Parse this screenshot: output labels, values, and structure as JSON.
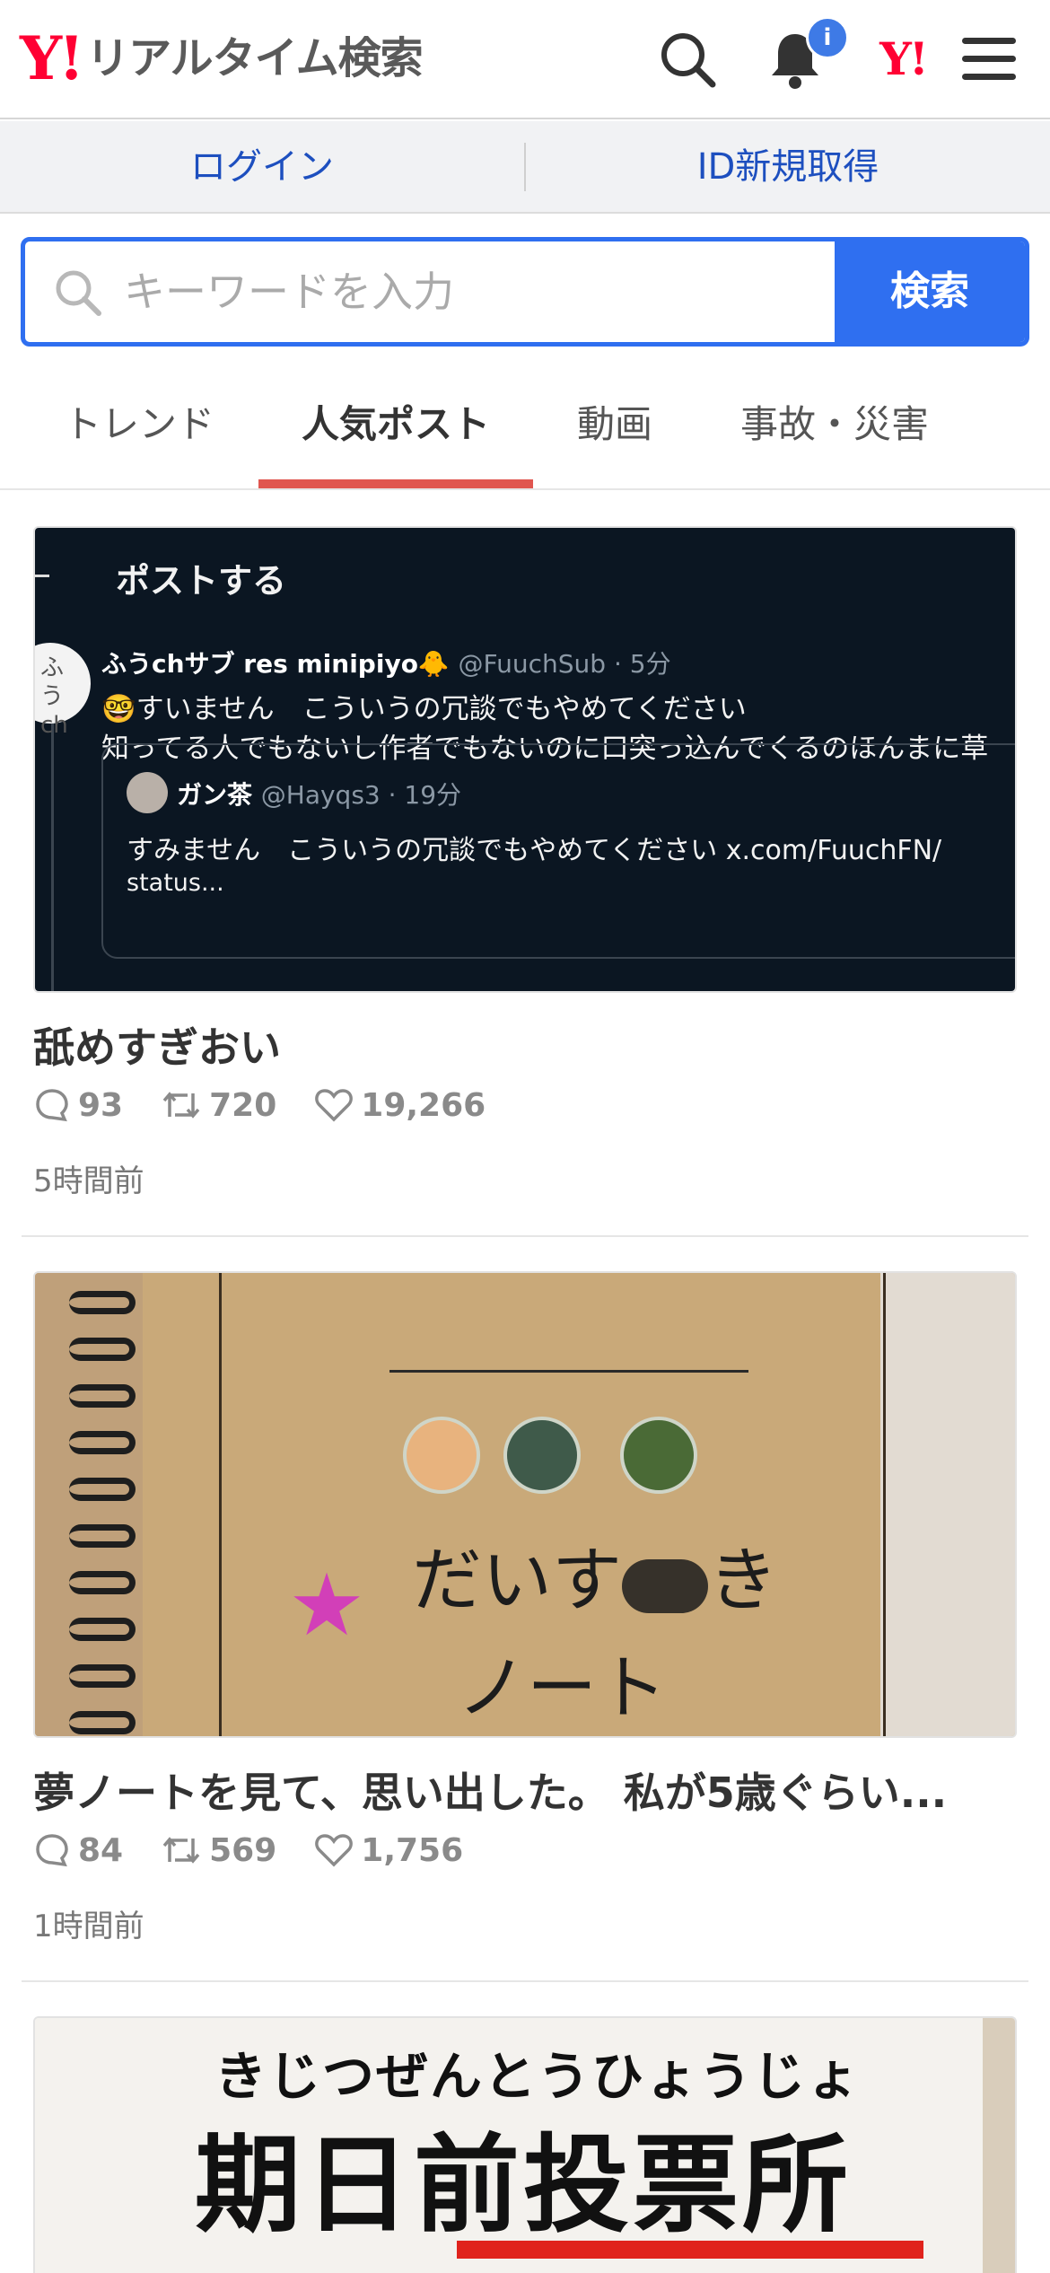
{
  "header": {
    "logo_mark": "Y!",
    "logo_text": "リアルタイム検索",
    "notification_badge": "i",
    "yj_mark": "Y!"
  },
  "loginbar": {
    "login": "ログイン",
    "signup": "ID新規取得"
  },
  "search": {
    "placeholder": "キーワードを入力",
    "button": "検索"
  },
  "tabs": [
    {
      "label": "トレンド",
      "active": false
    },
    {
      "label": "人気ポスト",
      "active": true
    },
    {
      "label": "動画",
      "active": false
    },
    {
      "label": "事故・災害",
      "active": false
    }
  ],
  "colors": {
    "accent_blue": "#2f6ff0",
    "logo_red": "#ff0033",
    "tab_underline": "#e0564f"
  },
  "posts": [
    {
      "title": "舐めすぎおい",
      "replies": "93",
      "reposts": "720",
      "likes": "19,266",
      "time": "5時間前",
      "image": {
        "header": "ポストする",
        "avatar_text": "ふう ch",
        "author": "ふうchサブ res minipiyo🐥",
        "handle": "@FuuchSub · 5分",
        "line1": "🤓すいません　こういうの冗談でもやめてください",
        "line2": "知ってる人でもないし作者でもないのに口突っ込んでくるのほんまに草",
        "quote_author": "ガン茶",
        "quote_handle": "@Hayqs3 · 19分",
        "quote_line1": "すみません　こういうの冗談でもやめてください x.com/FuuchFN/",
        "quote_line2": "status..."
      }
    },
    {
      "title": "夢ノートを見て、思い出した。 私が5歳ぐらい...",
      "replies": "84",
      "reposts": "569",
      "likes": "1,756",
      "time": "1時間前",
      "image": {
        "hand_line1": "だいす",
        "hand_line1_end": "き",
        "hand_line2": "ノート"
      }
    },
    {
      "image": {
        "kana": "きじつぜんとうひょうじょ",
        "main": "期日前投票所"
      }
    }
  ]
}
